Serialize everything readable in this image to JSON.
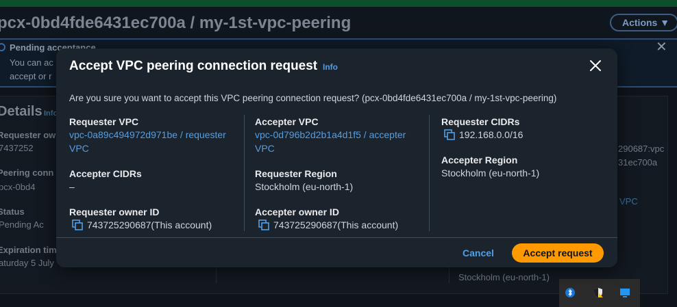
{
  "background": {
    "title": "pcx-0bd4fde6431ec700a / my-1st-vpc-peering",
    "actions_label": "Actions ▼",
    "banner_title": "Pending acceptance",
    "banner_line1": "You can ac",
    "banner_line2": "accept or r",
    "details_heading": "Details",
    "details_info": "Info",
    "requester_owner_label": "Requester ow",
    "requester_owner_value": "7437252",
    "peering_conn_label": "Peering conn",
    "peering_conn_value": "pcx-0bd4",
    "status_label": "Status",
    "status_value": "Pending Ac",
    "expiration_label": "Expiration tim",
    "expiration_value": "aturday 5 July",
    "right_text1": "290687:vpc",
    "right_text2": "31ec700a",
    "right_link": "VPC",
    "right_region": "Stockholm (eu-north-1)"
  },
  "modal": {
    "title": "Accept VPC peering connection request",
    "info_label": "Info",
    "question": "Are you sure you want to accept this VPC peering connection request? (pcx-0bd4fde6431ec700a / my-1st-vpc-peering)",
    "col1": {
      "requester_vpc_label": "Requester VPC",
      "requester_vpc_line1": "vpc-0a89c494972d971be / requester",
      "requester_vpc_line2": "VPC",
      "accepter_cidrs_label": "Accepter CIDRs",
      "accepter_cidrs_value": "–",
      "requester_owner_label": "Requester owner ID",
      "requester_owner_value": "743725290687(This account)"
    },
    "col2": {
      "accepter_vpc_label": "Accepter VPC",
      "accepter_vpc_line1": "vpc-0d796b2d2b1a4d1f5 / accepter",
      "accepter_vpc_line2": "VPC",
      "requester_region_label": "Requester Region",
      "requester_region_value": "Stockholm (eu-north-1)",
      "accepter_owner_label": "Accepter owner ID",
      "accepter_owner_value": "743725290687(This account)"
    },
    "col3": {
      "requester_cidrs_label": "Requester CIDRs",
      "requester_cidrs_value": "192.168.0.0/16",
      "accepter_region_label": "Accepter Region",
      "accepter_region_value": "Stockholm (eu-north-1)"
    },
    "cancel_label": "Cancel",
    "accept_label": "Accept request"
  },
  "colors": {
    "accent": "#ff9900",
    "link": "#539fe5",
    "modal_bg": "#1b232d"
  }
}
